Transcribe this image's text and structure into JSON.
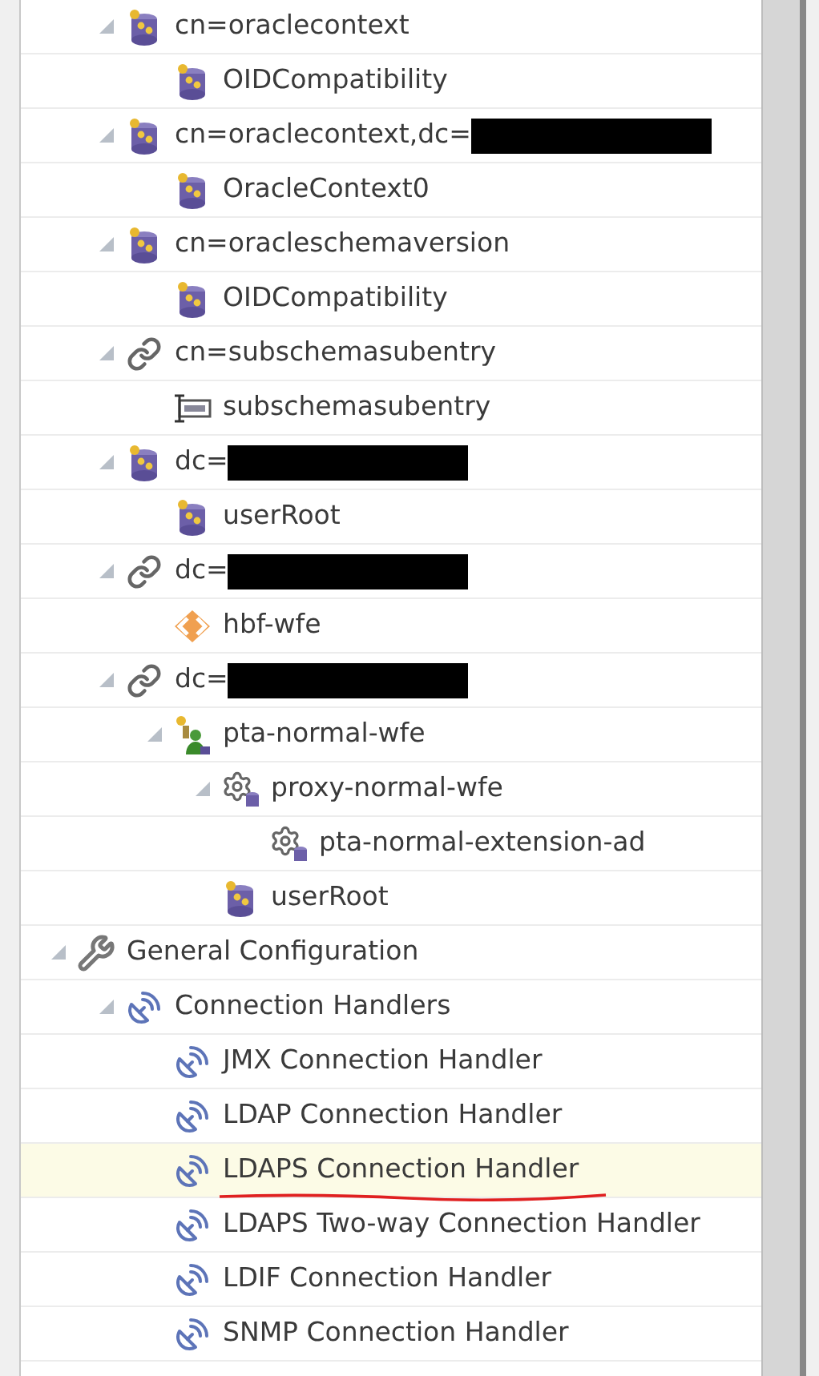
{
  "tree": {
    "continued_items": [
      {
        "label": "cn=oraclecontext",
        "kind": "database",
        "expanded": true,
        "selected": false,
        "children": [
          {
            "label": "OIDCompatibility",
            "kind": "database",
            "selected": false
          }
        ]
      },
      {
        "label": "cn=oraclecontext,dc=",
        "redacted": true,
        "kind": "database",
        "expanded": true,
        "selected": false,
        "children": [
          {
            "label": "OracleContext0",
            "kind": "database",
            "selected": false
          }
        ]
      },
      {
        "label": "cn=oracleschemaversion",
        "kind": "database",
        "expanded": true,
        "selected": false,
        "children": [
          {
            "label": "OIDCompatibility",
            "kind": "database",
            "selected": false
          }
        ]
      },
      {
        "label": "cn=subschemasubentry",
        "kind": "link",
        "expanded": true,
        "selected": false,
        "children": [
          {
            "label": "subschemasubentry",
            "kind": "template",
            "selected": false
          }
        ]
      },
      {
        "label": "dc=",
        "redacted": true,
        "kind": "database",
        "expanded": true,
        "selected": false,
        "children": [
          {
            "label": "userRoot",
            "kind": "database",
            "selected": false
          }
        ]
      },
      {
        "label": "dc=",
        "redacted": true,
        "kind": "link",
        "expanded": true,
        "selected": false,
        "children": [
          {
            "label": "hbf-wfe",
            "kind": "diamond",
            "selected": false
          }
        ]
      },
      {
        "label": "dc=",
        "redacted": true,
        "kind": "link",
        "expanded": true,
        "selected": false,
        "children": [
          {
            "label": "pta-normal-wfe",
            "kind": "workflow",
            "expanded": true,
            "selected": false,
            "children": [
              {
                "label": "proxy-normal-wfe",
                "kind": "gear",
                "expanded": true,
                "selected": false,
                "children": [
                  {
                    "label": "pta-normal-extension-ad",
                    "kind": "gear",
                    "selected": false
                  }
                ]
              },
              {
                "label": "userRoot",
                "kind": "database",
                "selected": false
              }
            ]
          }
        ]
      }
    ],
    "items": [
      {
        "label": "General Configuration",
        "kind": "wrench",
        "expanded": true,
        "selected": false,
        "children": [
          {
            "label": "Connection Handlers",
            "kind": "handler",
            "expanded": true,
            "selected": false,
            "children": [
              {
                "label": "JMX Connection Handler",
                "kind": "handler",
                "selected": false
              },
              {
                "label": "LDAP Connection Handler",
                "kind": "handler",
                "selected": false
              },
              {
                "label": "LDAPS Connection Handler",
                "kind": "handler",
                "selected": true,
                "underlined": true
              },
              {
                "label": "LDAPS Two-way Connection Handler",
                "kind": "handler",
                "selected": false
              },
              {
                "label": "LDIF Connection Handler",
                "kind": "handler",
                "selected": false
              },
              {
                "label": "SNMP Connection Handler",
                "kind": "handler",
                "selected": false
              }
            ]
          }
        ]
      }
    ]
  }
}
